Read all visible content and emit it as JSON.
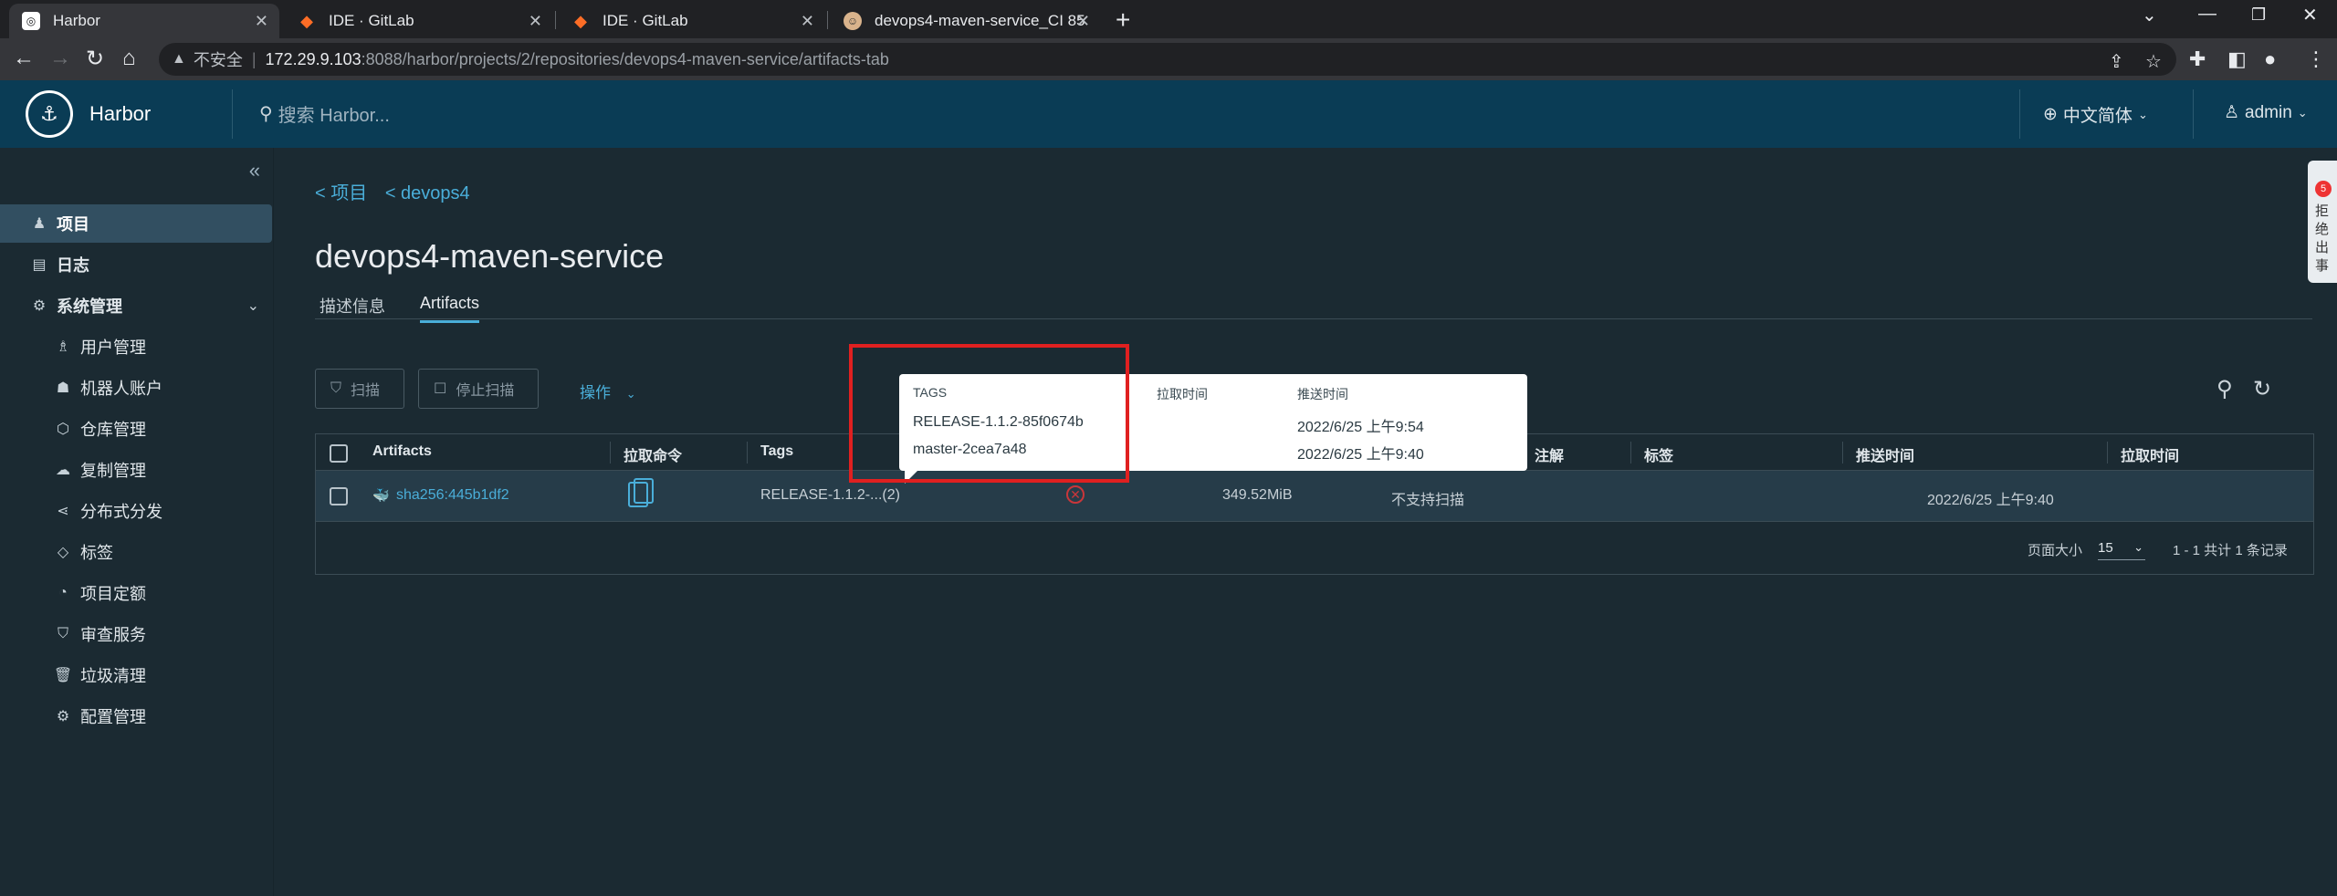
{
  "browser": {
    "tabs": [
      {
        "title": "Harbor",
        "active": true
      },
      {
        "title": "IDE · GitLab",
        "active": false
      },
      {
        "title": "IDE · GitLab",
        "active": false
      },
      {
        "title": "devops4-maven-service_CI 85",
        "active": false
      }
    ],
    "address": {
      "insecure_label": "不安全",
      "host": "172.29.9.103",
      "path": ":8088/harbor/projects/2/repositories/devops4-maven-service/artifacts-tab"
    }
  },
  "header": {
    "brand": "Harbor",
    "search_placeholder": "搜索 Harbor...",
    "language": "中文简体",
    "user": "admin"
  },
  "sidebar": {
    "items": [
      {
        "label": "项目",
        "icon": "project-icon",
        "active": true,
        "level": 1
      },
      {
        "label": "日志",
        "icon": "log-icon",
        "level": 1
      },
      {
        "label": "系统管理",
        "icon": "admin-icon",
        "level": 1,
        "expandable": true
      },
      {
        "label": "用户管理",
        "icon": "users-icon",
        "level": 2
      },
      {
        "label": "机器人账户",
        "icon": "robot-icon",
        "level": 2
      },
      {
        "label": "仓库管理",
        "icon": "registry-icon",
        "level": 2
      },
      {
        "label": "复制管理",
        "icon": "replication-icon",
        "level": 2
      },
      {
        "label": "分布式分发",
        "icon": "distribution-icon",
        "level": 2
      },
      {
        "label": "标签",
        "icon": "tag-icon",
        "level": 2
      },
      {
        "label": "项目定额",
        "icon": "quota-icon",
        "level": 2
      },
      {
        "label": "审查服务",
        "icon": "shield-icon",
        "level": 2
      },
      {
        "label": "垃圾清理",
        "icon": "trash-icon",
        "level": 2
      },
      {
        "label": "配置管理",
        "icon": "gear-icon",
        "level": 2
      }
    ]
  },
  "main": {
    "breadcrumb": [
      "< 项目",
      "< devops4"
    ],
    "title": "devops4-maven-service",
    "tabs": [
      {
        "label": "描述信息",
        "active": false
      },
      {
        "label": "Artifacts",
        "active": true
      }
    ],
    "toolbar": {
      "scan": "扫描",
      "stop_scan": "停止扫描",
      "actions": "操作"
    },
    "table": {
      "columns": [
        "Artifacts",
        "拉取命令",
        "Tags",
        "注解",
        "标签",
        "推送时间",
        "拉取时间"
      ],
      "rows": [
        {
          "artifact": "sha256:445b1df2",
          "tags": "RELEASE-1.1.2-...(2)",
          "size": "349.52MiB",
          "vuln": "不支持扫描",
          "push_time": "2022/6/25 上午9:40"
        }
      ],
      "footer": {
        "page_size_label": "页面大小",
        "page_size": "15",
        "summary": "1 - 1 共计 1 条记录"
      }
    },
    "tags_popup": {
      "headers": [
        "TAGS",
        "拉取时间",
        "推送时间"
      ],
      "rows": [
        {
          "tag": "RELEASE-1.1.2-85f0674b",
          "pull": "",
          "push": "2022/6/25 上午9:54"
        },
        {
          "tag": "master-2cea7a48",
          "pull": "",
          "push": "2022/6/25 上午9:40"
        }
      ]
    }
  },
  "side_widget": {
    "badge": "5",
    "text": "拒绝出事"
  }
}
